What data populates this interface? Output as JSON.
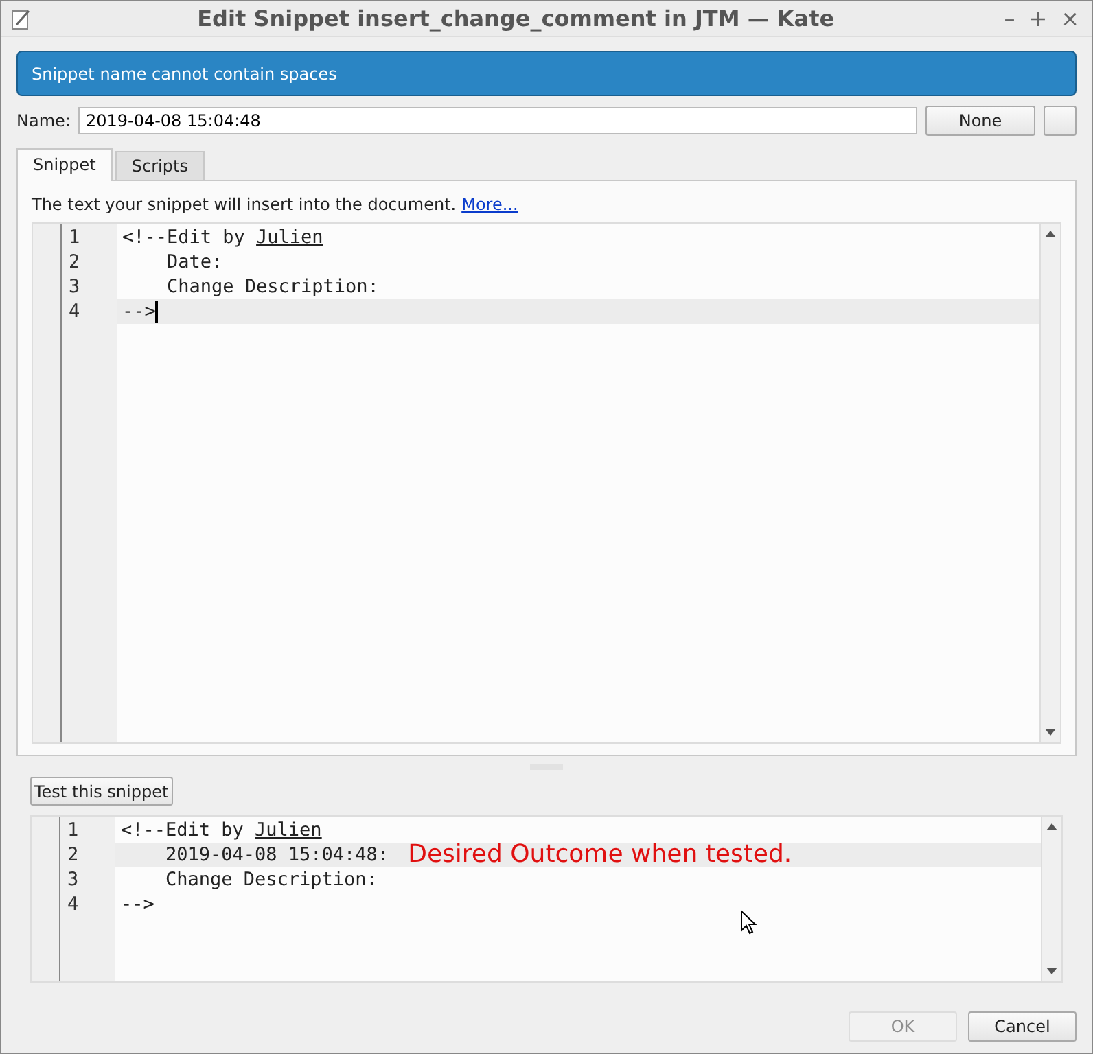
{
  "window": {
    "title": "Edit Snippet insert_change_comment in JTM — Kate",
    "controls": [
      "–",
      "+",
      "×"
    ]
  },
  "message": "Snippet name cannot contain spaces",
  "name": {
    "label": "Name:",
    "value": "2019-04-08 15:04:48"
  },
  "shortcut_button": "None",
  "tabs": [
    {
      "label": "Snippet",
      "selected": true
    },
    {
      "label": "Scripts",
      "selected": false
    }
  ],
  "hint": {
    "text": "The text your snippet will insert into the document.",
    "link": "More..."
  },
  "editor": {
    "lines": [
      {
        "number": "1",
        "current": false,
        "cursor": false,
        "parts": [
          {
            "text": "<!--Edit by ",
            "misspelled": false
          },
          {
            "text": "Julien",
            "misspelled": true
          }
        ]
      },
      {
        "number": "2",
        "current": false,
        "cursor": false,
        "parts": [
          {
            "text": "    Date:",
            "misspelled": false
          }
        ]
      },
      {
        "number": "3",
        "current": false,
        "cursor": false,
        "parts": [
          {
            "text": "    Change Description:",
            "misspelled": false
          }
        ]
      },
      {
        "number": "4",
        "current": true,
        "cursor": true,
        "parts": [
          {
            "text": "-->",
            "misspelled": false
          }
        ]
      }
    ]
  },
  "test_button": "Test this snippet",
  "test_output": {
    "lines": [
      {
        "number": "1",
        "current": false,
        "parts": [
          {
            "text": "<!--Edit by ",
            "misspelled": false
          },
          {
            "text": "Julien",
            "misspelled": true
          }
        ]
      },
      {
        "number": "2",
        "current": true,
        "parts": [
          {
            "text": "    2019-04-08 15:04:48:",
            "misspelled": false
          }
        ],
        "annotation": "Desired Outcome when tested."
      },
      {
        "number": "3",
        "current": false,
        "parts": [
          {
            "text": "    Change Description:",
            "misspelled": false
          }
        ]
      },
      {
        "number": "4",
        "current": false,
        "parts": [
          {
            "text": "-->",
            "misspelled": false
          }
        ]
      }
    ]
  },
  "buttons": [
    {
      "label": "OK",
      "disabled": true
    },
    {
      "label": "Cancel",
      "disabled": false
    }
  ]
}
